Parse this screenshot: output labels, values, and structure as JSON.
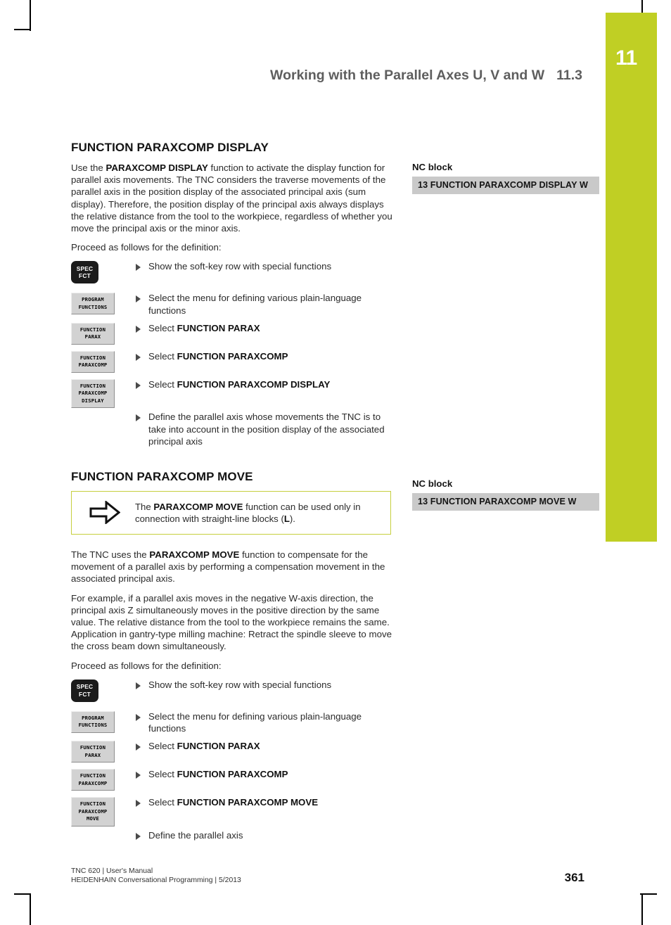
{
  "chapter_tab": {
    "number": "11",
    "color": "#c0cf24"
  },
  "running_head": {
    "title": "Working with the Parallel Axes U, V and W",
    "section_number": "11.3"
  },
  "sections": [
    {
      "id": "paraxcomp-display",
      "title": "FUNCTION PARAXCOMP DISPLAY",
      "intro_parts": [
        "Use the ",
        "PARAXCOMP DISPLAY",
        " function to activate the display function for parallel axis movements. The TNC considers the traverse movements of the parallel axis in the position display of the associated principal axis (sum display). Therefore, the position display of the principal axis always displays the relative distance from the tool to the workpiece, regardless of whether you move the principal axis or the minor axis."
      ],
      "proceed_label": "Proceed as follows for the definition:",
      "nc_label": "NC block",
      "nc_code": "13 FUNCTION PARAXCOMP DISPLAY W",
      "steps": [
        {
          "key_type": "hard",
          "key_lines": [
            "SPEC",
            "FCT"
          ],
          "text": "Show the soft-key row with special functions",
          "bold": ""
        },
        {
          "key_type": "soft",
          "key_lines": [
            "PROGRAM",
            "FUNCTIONS"
          ],
          "text": "Select the menu for defining various plain-language functions",
          "bold": ""
        },
        {
          "key_type": "soft",
          "key_lines": [
            "FUNCTION",
            "PARAX"
          ],
          "text": "Select ",
          "bold": "FUNCTION PARAX"
        },
        {
          "key_type": "soft",
          "key_lines": [
            "FUNCTION",
            "PARAXCOMP"
          ],
          "text": "Select ",
          "bold": "FUNCTION PARAXCOMP"
        },
        {
          "key_type": "soft",
          "key_lines": [
            "FUNCTION",
            "PARAXCOMP",
            "DISPLAY"
          ],
          "text": "Select ",
          "bold": "FUNCTION PARAXCOMP DISPLAY"
        },
        {
          "key_type": "none",
          "key_lines": [],
          "text": "Define the parallel axis whose movements the TNC is to take into account in the position display of the associated principal axis",
          "bold": ""
        }
      ]
    },
    {
      "id": "paraxcomp-move",
      "title": "FUNCTION PARAXCOMP MOVE",
      "note": {
        "icon": "arrow-right-outline-icon",
        "border_color": "#c6cf3e",
        "parts": [
          "The ",
          "PARAXCOMP MOVE",
          " function can be used only in connection with straight-line blocks (",
          "L",
          ")."
        ]
      },
      "paragraph1_parts": [
        "The TNC uses the ",
        "PARAXCOMP MOVE",
        " function to compensate for the movement of a parallel axis by performing a compensation movement in the associated principal axis."
      ],
      "paragraph2": "For example, if a parallel axis moves in the negative W-axis direction, the principal axis Z simultaneously moves in the positive direction by the same value. The relative distance from the tool to the workpiece remains the same. Application in gantry-type milling machine: Retract the spindle sleeve to move the cross beam down simultaneously.",
      "proceed_label": "Proceed as follows for the definition:",
      "nc_label": "NC block",
      "nc_code": "13 FUNCTION PARAXCOMP MOVE W",
      "steps": [
        {
          "key_type": "hard",
          "key_lines": [
            "SPEC",
            "FCT"
          ],
          "text": "Show the soft-key row with special functions",
          "bold": ""
        },
        {
          "key_type": "soft",
          "key_lines": [
            "PROGRAM",
            "FUNCTIONS"
          ],
          "text": "Select the menu for defining various plain-language functions",
          "bold": ""
        },
        {
          "key_type": "soft",
          "key_lines": [
            "FUNCTION",
            "PARAX"
          ],
          "text": "Select ",
          "bold": "FUNCTION PARAX"
        },
        {
          "key_type": "soft",
          "key_lines": [
            "FUNCTION",
            "PARAXCOMP"
          ],
          "text": "Select ",
          "bold": "FUNCTION PARAXCOMP"
        },
        {
          "key_type": "soft",
          "key_lines": [
            "FUNCTION",
            "PARAXCOMP",
            "MOVE"
          ],
          "text": "Select ",
          "bold": "FUNCTION PARAXCOMP MOVE"
        },
        {
          "key_type": "none",
          "key_lines": [],
          "text": "Define the parallel axis",
          "bold": ""
        }
      ]
    }
  ],
  "footer": {
    "line1": "TNC 620 | User's Manual",
    "line2": "HEIDENHAIN Conversational Programming | 5/2013",
    "page_number": "361"
  }
}
